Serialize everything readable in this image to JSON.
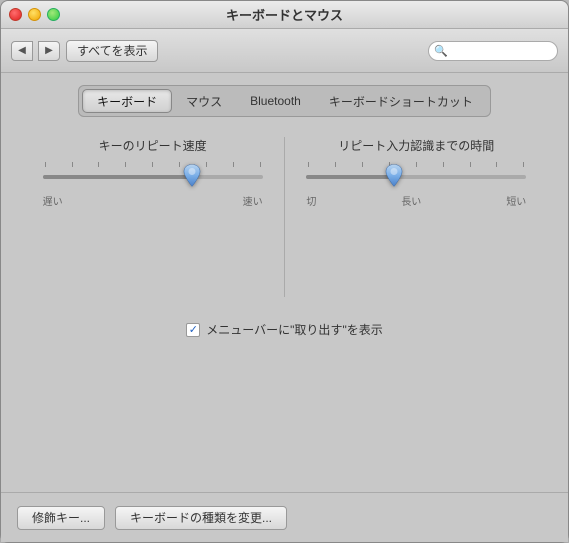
{
  "window": {
    "title": "キーボードとマウス"
  },
  "toolbar": {
    "back_label": "‹",
    "forward_label": "›",
    "show_all_label": "すべてを表示",
    "search_placeholder": ""
  },
  "tabs": [
    {
      "id": "keyboard",
      "label": "キーボード",
      "active": true
    },
    {
      "id": "mouse",
      "label": "マウス",
      "active": false
    },
    {
      "id": "bluetooth",
      "label": "Bluetooth",
      "active": false
    },
    {
      "id": "shortcuts",
      "label": "キーボードショートカット",
      "active": false
    }
  ],
  "sliders": {
    "repeat_speed": {
      "label": "キーのリピート速度",
      "value_pct": 68,
      "label_left": "遅い",
      "label_right": "速い"
    },
    "repeat_delay": {
      "label": "リピート入力認識までの時間",
      "value_pct": 40,
      "label_left1": "切",
      "label_left2": "長い",
      "label_right": "短い"
    }
  },
  "checkbox": {
    "checked": true,
    "label": "メニューバーに\"取り出す\"を表示"
  },
  "buttons": {
    "modifier_keys": "修飾キー...",
    "change_keyboard": "キーボードの種類を変更..."
  }
}
